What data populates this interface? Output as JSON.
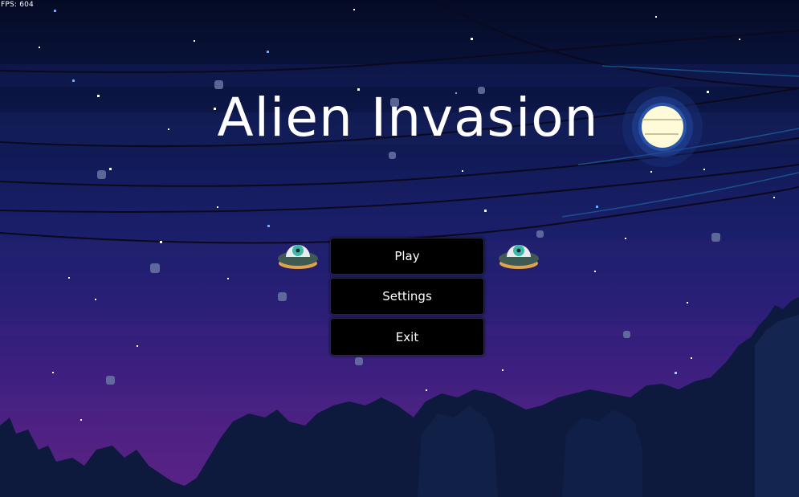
{
  "hud": {
    "fps_text": "FPS: 604"
  },
  "title": "Alien Invasion",
  "menu": {
    "items": [
      {
        "label": "Play"
      },
      {
        "label": "Settings"
      },
      {
        "label": "Exit"
      }
    ],
    "selected_index": 0
  },
  "icons": {
    "left_marker": "ufo-icon",
    "right_marker": "ufo-icon",
    "moon": "moon-icon"
  },
  "colors": {
    "sky_top": "#050b25",
    "sky_mid": "#1d1f6e",
    "sky_bottom": "#5a2386",
    "trees": "#0d1a3e",
    "moon": "#fffbd8",
    "button_bg": "#000000",
    "text": "#ffffff",
    "ufo_body": "#3e5a52",
    "ufo_eye": "#3fb8a8",
    "ufo_base": "#e3a24a"
  }
}
